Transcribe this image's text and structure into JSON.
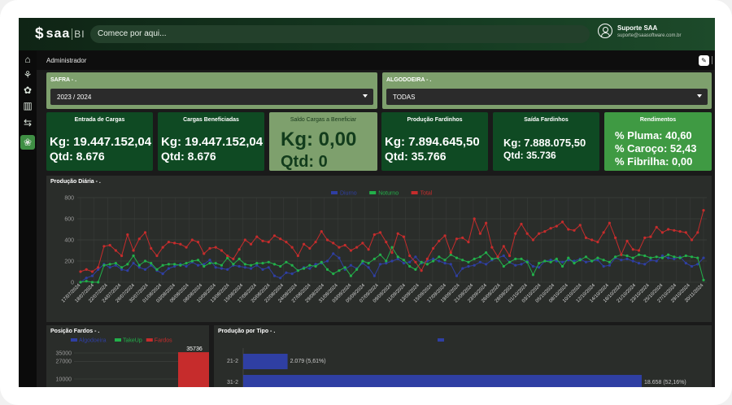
{
  "app": {
    "logo_text": "saa",
    "logo_suffix": "BI",
    "search_placeholder": "Comece por aqui...",
    "user_name": "Suporte SAA",
    "user_email": "suporte@saasoftware.com.br"
  },
  "sidebar": {
    "icons": [
      "home-icon",
      "plant-icon",
      "hand-plant-icon",
      "book-icon",
      "exchange-icon",
      "cotton-icon"
    ],
    "active_index": 5
  },
  "header": {
    "title": "Administrador"
  },
  "filters": {
    "safra": {
      "label": "SAFRA - .",
      "value": "2023 / 2024"
    },
    "algodoeira": {
      "label": "ALGODOEIRA - .",
      "value": "TODAS"
    }
  },
  "cards": [
    {
      "title": "Entrada de Cargas",
      "kg": "Kg: 19.447.152,04",
      "qtd": "Qtd: 8.676"
    },
    {
      "title": "Cargas Beneficiadas",
      "kg": "Kg: 19.447.152,04",
      "qtd": "Qtd: 8.676"
    },
    {
      "title": "Saldo Cargas a Beneficiar",
      "kg": "Kg: 0,00",
      "qtd": "Qtd: 0"
    },
    {
      "title": "Produção Fardinhos",
      "kg": "Kg: 7.894.645,50",
      "qtd": "Qtd: 35.766"
    },
    {
      "title": "Saída Fardinhos",
      "kg": "Kg: 7.888.075,50",
      "qtd": "Qtd: 35.736"
    }
  ],
  "rendimentos": {
    "title": "Rendimentos",
    "lines": [
      "% Pluma: 40,60",
      "% Caroço: 52,43",
      "% Fibrilha: 0,00"
    ]
  },
  "panels": {
    "daily": {
      "title": "Produção Diária - ."
    },
    "fardos": {
      "title": "Posição Fardos - ."
    },
    "tipo": {
      "title": "Produção por Tipo - ."
    }
  },
  "chart_data": [
    {
      "type": "line",
      "title": "Produção Diária - .",
      "legend": [
        "Diurno",
        "Noturno",
        "Total"
      ],
      "colors": [
        "#2f3fa3",
        "#22b04a",
        "#c62c2c"
      ],
      "ylim": [
        0,
        800
      ],
      "yticks": [
        0,
        200,
        400,
        600,
        800
      ],
      "x": [
        "17/07/2024",
        "18/07/2024",
        "22/07/2024",
        "24/07/2024",
        "26/07/2024",
        "30/07/2024",
        "01/08/2024",
        "03/08/2024",
        "06/08/2024",
        "08/08/2024",
        "10/08/2024",
        "13/08/2024",
        "15/08/2024",
        "17/08/2024",
        "20/08/2024",
        "22/08/2024",
        "24/08/2024",
        "27/08/2024",
        "29/08/2024",
        "31/08/2024",
        "03/09/2024",
        "05/09/2024",
        "07/09/2024",
        "09/09/2024",
        "11/09/2024",
        "13/09/2024",
        "15/09/2024",
        "17/09/2024",
        "19/09/2024",
        "21/09/2024",
        "23/09/2024",
        "26/09/2024",
        "28/09/2024",
        "01/10/2024",
        "03/10/2024",
        "05/10/2024",
        "08/10/2024",
        "10/10/2024",
        "12/10/2024",
        "14/10/2024",
        "16/10/2024",
        "21/10/2024",
        "23/10/2024",
        "25/10/2024",
        "27/10/2024",
        "29/10/2024",
        "20/11/2024"
      ],
      "series": [
        {
          "name": "Diurno",
          "values": [
            0,
            40,
            60,
            120,
            170,
            140,
            160,
            120,
            110,
            180,
            140,
            120,
            160,
            110,
            80,
            130,
            150,
            170,
            150,
            190,
            160,
            170,
            210,
            140,
            130,
            120,
            160,
            150,
            140,
            130,
            160,
            120,
            140,
            60,
            40,
            90,
            80,
            110,
            140,
            130,
            170,
            180,
            200,
            270,
            230,
            120,
            160,
            130,
            180,
            140,
            60,
            170,
            180,
            200,
            220,
            180,
            190,
            240,
            180,
            200,
            220,
            200,
            180,
            170,
            60,
            130,
            150,
            160,
            190,
            170,
            210,
            230,
            250,
            190,
            160,
            170,
            200,
            150,
            140,
            200,
            210,
            200,
            190,
            210,
            200,
            220,
            190,
            200,
            210,
            150,
            160,
            230,
            210,
            220,
            200,
            180,
            170,
            210,
            200,
            250,
            230,
            220,
            240,
            180,
            150,
            170,
            230
          ]
        },
        {
          "name": "Noturno",
          "values": [
            0,
            10,
            0,
            0,
            160,
            170,
            180,
            140,
            170,
            250,
            160,
            200,
            180,
            120,
            160,
            170,
            170,
            160,
            180,
            200,
            210,
            150,
            180,
            180,
            160,
            230,
            170,
            220,
            170,
            160,
            180,
            180,
            190,
            170,
            150,
            190,
            160,
            110,
            130,
            160,
            150,
            190,
            120,
            80,
            110,
            140,
            60,
            120,
            200,
            180,
            220,
            260,
            200,
            330,
            240,
            210,
            150,
            120,
            190,
            170,
            200,
            240,
            210,
            260,
            230,
            210,
            190,
            220,
            240,
            280,
            220,
            230,
            150,
            190,
            220,
            220,
            190,
            70,
            180,
            200,
            190,
            220,
            150,
            230,
            180,
            210,
            240,
            200,
            230,
            210,
            190,
            240,
            260,
            250,
            230,
            260,
            250,
            230,
            240,
            230,
            260,
            240,
            230,
            250,
            240,
            230,
            20
          ]
        },
        {
          "name": "Total",
          "values": [
            100,
            120,
            100,
            140,
            340,
            350,
            300,
            250,
            450,
            300,
            410,
            470,
            320,
            250,
            330,
            380,
            370,
            360,
            330,
            400,
            380,
            270,
            320,
            330,
            300,
            250,
            220,
            310,
            400,
            360,
            430,
            390,
            380,
            440,
            410,
            380,
            330,
            250,
            360,
            320,
            380,
            480,
            400,
            370,
            330,
            350,
            300,
            330,
            370,
            310,
            450,
            470,
            380,
            280,
            460,
            430,
            250,
            190,
            110,
            220,
            320,
            390,
            440,
            280,
            410,
            420,
            380,
            600,
            460,
            560,
            330,
            240,
            340,
            250,
            460,
            550,
            460,
            400,
            460,
            480,
            510,
            530,
            570,
            500,
            490,
            540,
            420,
            400,
            380,
            470,
            560,
            420,
            260,
            390,
            310,
            300,
            420,
            430,
            520,
            470,
            500,
            490,
            480,
            470,
            400,
            470,
            680
          ]
        }
      ]
    },
    {
      "type": "bar",
      "title": "Posição Fardos - .",
      "legend": [
        "Algodoeira",
        "TakeUp",
        "Fardos"
      ],
      "colors": [
        "#2f3fa3",
        "#22b04a",
        "#c62c2c"
      ],
      "yticks": [
        10000,
        27000,
        35000
      ],
      "ytick_labels": [
        "10000",
        "27000",
        "35000"
      ],
      "values": [
        0,
        0,
        35736
      ],
      "data_label": "35736"
    },
    {
      "type": "bar",
      "title": "Produção por Tipo - .",
      "categories": [
        "21-2",
        "31-2"
      ],
      "values": [
        2079,
        18658
      ],
      "labels": [
        "2.079 (5,61%)",
        "18.658 (52,16%)"
      ],
      "color": "#2f3fa3"
    }
  ]
}
